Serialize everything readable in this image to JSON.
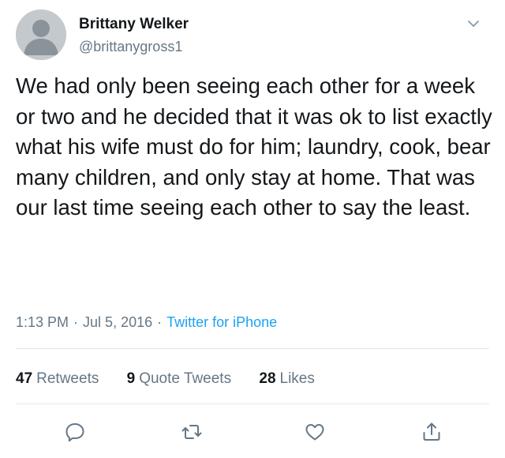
{
  "author": {
    "name": "Brittany Welker",
    "handle": "@brittanygross1"
  },
  "tweet": {
    "text": "We had only been seeing each other for a week or two and he decided that it was ok to list exactly what his wife must do for him; laundry, cook, bear many children, and only stay at home. That was our last time seeing each other to say the least."
  },
  "meta": {
    "time": "1:13 PM",
    "date": "Jul 5, 2016",
    "separator": "·",
    "source": "Twitter for iPhone"
  },
  "stats": {
    "retweets_count": "47",
    "retweets_label": "Retweets",
    "quotes_count": "9",
    "quotes_label": "Quote Tweets",
    "likes_count": "28",
    "likes_label": "Likes"
  },
  "actions": {
    "icons": [
      "reply-icon",
      "retweet-icon",
      "like-icon",
      "share-icon"
    ]
  },
  "colors": {
    "text": "#14171a",
    "secondary": "#657786",
    "link": "#1da1f2",
    "divider": "#e1e8ed",
    "icon": "#657786"
  }
}
